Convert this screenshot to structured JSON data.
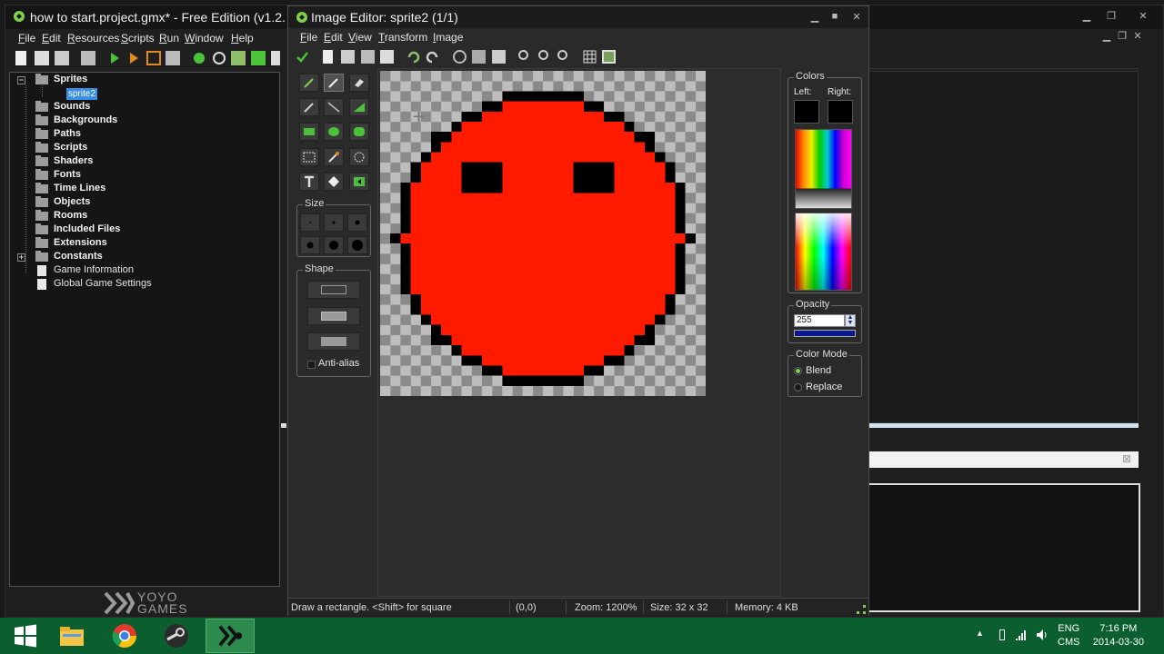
{
  "main_window": {
    "title": "how to start.project.gmx*  -  Free Edition (v1.2.",
    "menu": [
      {
        "pre": "",
        "u": "F",
        "post": "ile"
      },
      {
        "pre": "",
        "u": "E",
        "post": "dit"
      },
      {
        "pre": "",
        "u": "R",
        "post": "esources"
      },
      {
        "pre": "",
        "u": "S",
        "post": "cripts"
      },
      {
        "pre": "",
        "u": "R",
        "post": "un"
      },
      {
        "pre": "",
        "u": "W",
        "post": "indow"
      },
      {
        "pre": "",
        "u": "H",
        "post": "elp"
      }
    ],
    "tree": {
      "sprites": "Sprites",
      "sprite_item": "sprite2",
      "sounds": "Sounds",
      "backgrounds": "Backgrounds",
      "paths": "Paths",
      "scripts": "Scripts",
      "shaders": "Shaders",
      "fonts": "Fonts",
      "time_lines": "Time Lines",
      "objects": "Objects",
      "rooms": "Rooms",
      "included_files": "Included Files",
      "extensions": "Extensions",
      "constants": "Constants",
      "game_information": "Game Information",
      "global_game_settings": "Global Game Settings"
    },
    "logo_text_1": "YOYO",
    "logo_text_2": "GAMES"
  },
  "editor": {
    "title": "Image Editor: sprite2 (1/1)",
    "menu": [
      {
        "pre": "",
        "u": "F",
        "post": "ile"
      },
      {
        "pre": "",
        "u": "E",
        "post": "dit"
      },
      {
        "pre": "",
        "u": "V",
        "post": "iew"
      },
      {
        "pre": "",
        "u": "T",
        "post": "ransform"
      },
      {
        "pre": "",
        "u": "I",
        "post": "mage"
      }
    ],
    "size_label": "Size",
    "shape_label": "Shape",
    "antialias_label": "Anti-alias",
    "colors_label": "Colors",
    "left_label": "Left:",
    "right_label": "Right:",
    "opacity_label": "Opacity",
    "opacity_value": "255",
    "color_mode_label": "Color Mode",
    "blend_label": "Blend",
    "replace_label": "Replace",
    "status": {
      "hint": "Draw a rectangle. <Shift> for square",
      "coords": "(0,0)",
      "zoom": "Zoom: 1200%",
      "size": "Size: 32 x 32",
      "memory": "Memory: 4 KB"
    }
  },
  "taskbar": {
    "lang_1": "ENG",
    "lang_2": "CMS",
    "time": "7:16 PM",
    "date": "2014-03-30"
  },
  "colors": {
    "accent_blue": "#3a8ee6",
    "sprite_red": "#ff1a00",
    "outline": "#000000",
    "taskbar_green": "#0b5e2e",
    "opacity_bar": "#0a1a8c"
  }
}
